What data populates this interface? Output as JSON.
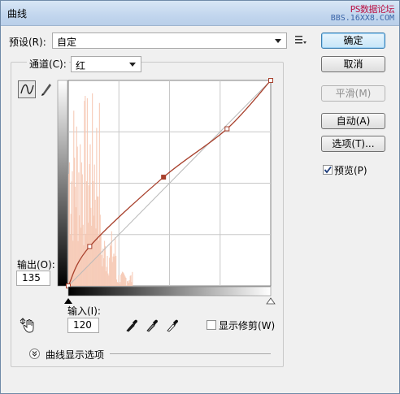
{
  "window": {
    "title": "曲线",
    "watermark_line1": "PS数据论坛",
    "watermark_line2": "BBS.16XX8.COM"
  },
  "preset": {
    "label": "预设(R):",
    "value": "自定"
  },
  "channel": {
    "label": "通道(C):",
    "value": "红"
  },
  "buttons": {
    "ok": "确定",
    "cancel": "取消",
    "smooth": "平滑(M)",
    "auto": "自动(A)",
    "options": "选项(T)..."
  },
  "preview": {
    "label": "预览(P)",
    "checked": true
  },
  "output": {
    "label": "输出(O):",
    "value": "135"
  },
  "input": {
    "label": "输入(I):",
    "value": "120"
  },
  "show_clipping": {
    "label": "显示修剪(W)",
    "checked": false
  },
  "curve_options": {
    "label": "曲线显示选项"
  },
  "curve": {
    "points": [
      [
        0,
        0
      ],
      [
        27,
        49
      ],
      [
        120,
        135
      ],
      [
        200,
        195
      ],
      [
        255,
        255
      ]
    ],
    "histogram_color": "#f6c7b2",
    "curve_color": "#a8402c"
  },
  "icons": {
    "preset_menu": "preset-options-icon",
    "curve_tool": "curve-tool-icon",
    "pencil_tool": "pencil-icon",
    "hand_tool": "target-adjust-icon",
    "eyedropper_black": "eyedropper-black-icon",
    "eyedropper_gray": "eyedropper-gray-icon",
    "eyedropper_white": "eyedropper-white-icon"
  }
}
